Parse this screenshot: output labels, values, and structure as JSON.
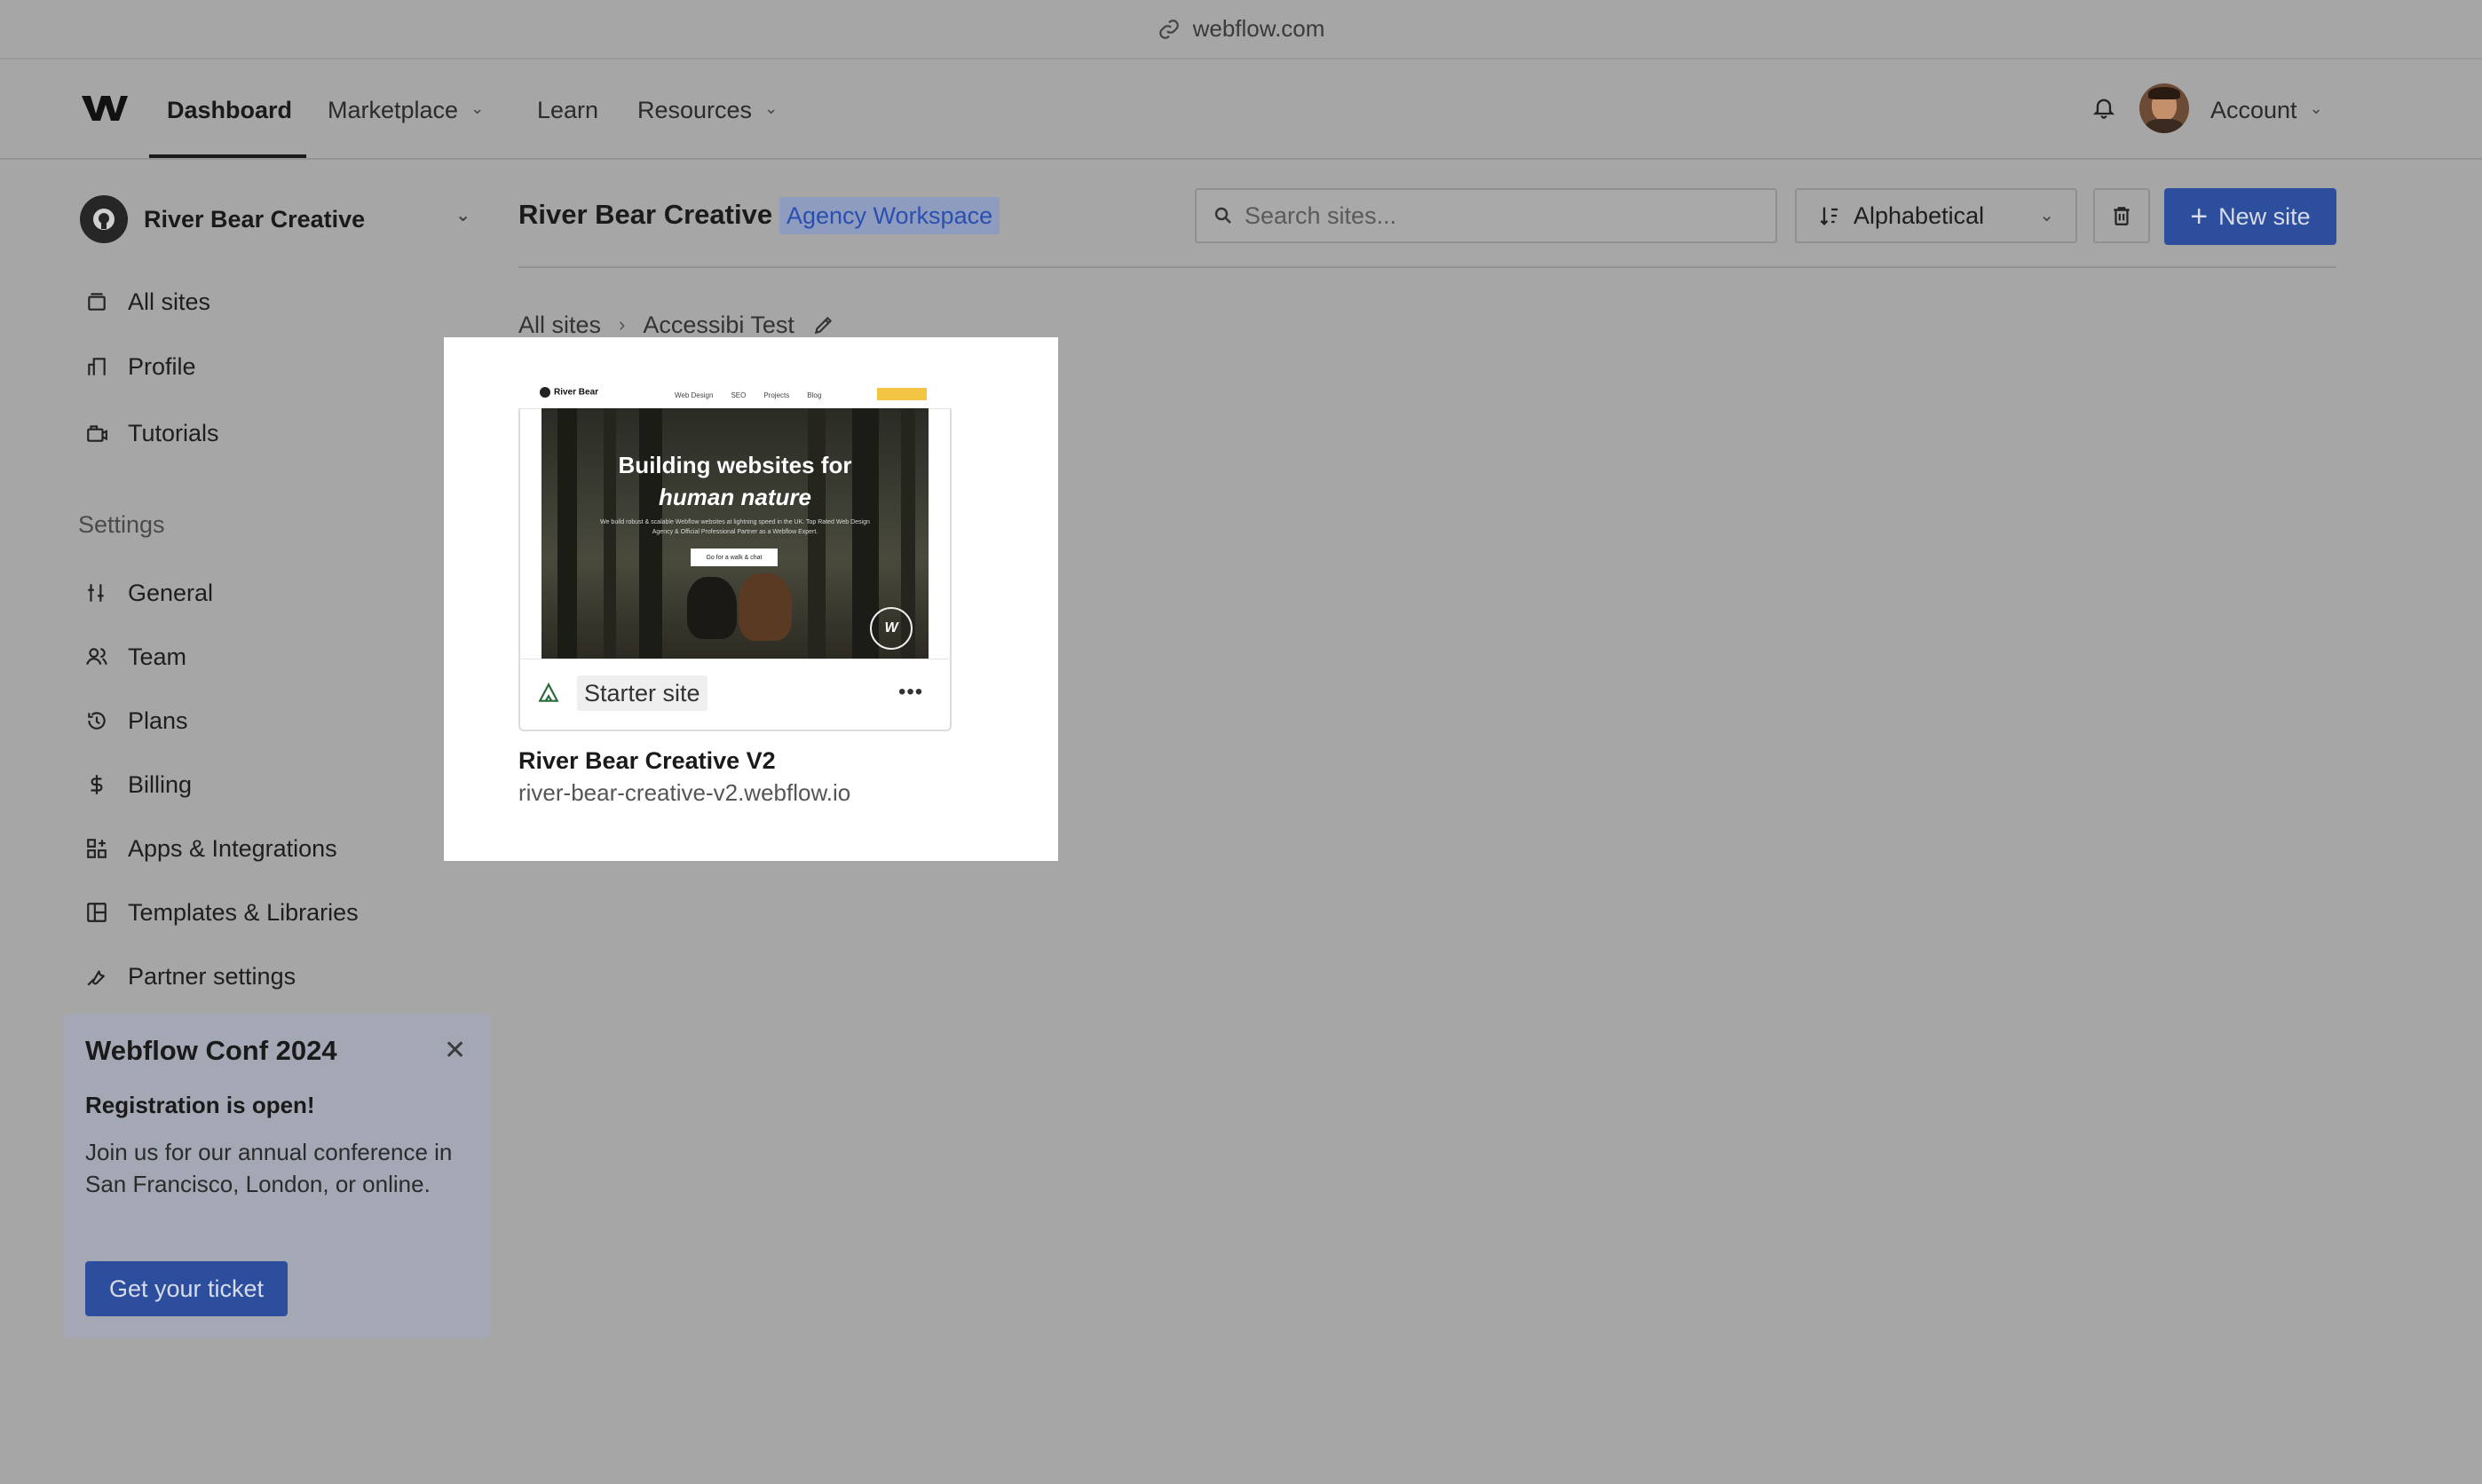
{
  "browser": {
    "url": "webflow.com"
  },
  "topnav": {
    "items": [
      {
        "label": "Dashboard"
      },
      {
        "label": "Marketplace"
      },
      {
        "label": "Learn"
      },
      {
        "label": "Resources"
      }
    ],
    "account_label": "Account"
  },
  "sidebar": {
    "workspace_name": "River Bear Creative",
    "items": [
      {
        "label": "All sites",
        "icon": "all-sites-icon"
      },
      {
        "label": "Profile",
        "icon": "profile-icon"
      },
      {
        "label": "Tutorials",
        "icon": "tutorials-icon"
      }
    ],
    "settings_heading": "Settings",
    "settings_items": [
      {
        "label": "General",
        "icon": "sliders-icon"
      },
      {
        "label": "Team",
        "icon": "team-icon"
      },
      {
        "label": "Plans",
        "icon": "plans-icon"
      },
      {
        "label": "Billing",
        "icon": "dollar-icon"
      },
      {
        "label": "Apps & Integrations",
        "icon": "apps-icon"
      },
      {
        "label": "Templates & Libraries",
        "icon": "templates-icon"
      },
      {
        "label": "Partner settings",
        "icon": "wrench-icon"
      }
    ]
  },
  "promo": {
    "title": "Webflow Conf 2024",
    "subtitle": "Registration is open!",
    "body": "Join us for our annual conference in San Francisco, London, or online.",
    "button": "Get your ticket"
  },
  "main": {
    "title": "River Bear Creative",
    "badge": "Agency Workspace",
    "search_placeholder": "Search sites...",
    "sort_value": "Alphabetical",
    "new_site_label": "New site",
    "breadcrumb": [
      "All sites",
      "Accessibi Test"
    ]
  },
  "site_card": {
    "name": "River Bear Creative V2",
    "url": "river-bear-creative-v2.webflow.io",
    "tag": "Starter site",
    "thumbnail": {
      "brand": "River Bear",
      "links": [
        "Web Design",
        "SEO",
        "Projects",
        "Blog"
      ],
      "headline_line1": "Building websites for",
      "headline_line2": "human nature",
      "blurb": "We build robust & scalable Webflow websites at lightning speed in the UK. Top Rated Web Design Agency & Official Professional Partner as a Webflow Expert.",
      "cta": "Go for a walk & chat"
    }
  },
  "colors": {
    "accent": "#2d4d9d",
    "page_overlay": "#a6a6a6",
    "badge_text": "#2a4fb0"
  }
}
